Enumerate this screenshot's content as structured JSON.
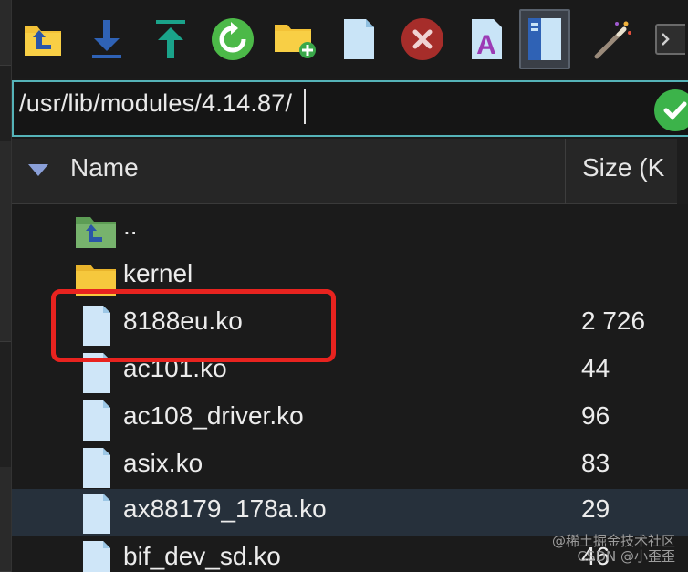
{
  "toolbar": {
    "buttons": [
      {
        "name": "parent-directory",
        "icon": "folder-up-icon"
      },
      {
        "name": "download",
        "icon": "download-icon"
      },
      {
        "name": "upload",
        "icon": "upload-icon"
      },
      {
        "name": "refresh",
        "icon": "refresh-icon"
      },
      {
        "name": "new-folder",
        "icon": "new-folder-icon"
      },
      {
        "name": "new-file",
        "icon": "new-file-icon"
      },
      {
        "name": "delete",
        "icon": "delete-icon"
      },
      {
        "name": "rename",
        "icon": "rename-icon"
      },
      {
        "name": "toggle-panel",
        "icon": "panel-icon",
        "active": true
      },
      {
        "name": "tools",
        "icon": "magic-wand-icon"
      },
      {
        "name": "terminal",
        "icon": "terminal-icon"
      }
    ]
  },
  "address": {
    "path": "/usr/lib/modules/4.14.87/"
  },
  "columns": {
    "name": "Name",
    "size": "Size (K"
  },
  "files": [
    {
      "name": "..",
      "size": "",
      "type": "parent"
    },
    {
      "name": "kernel",
      "size": "",
      "type": "folder"
    },
    {
      "name": "8188eu.ko",
      "size": "2 726",
      "type": "file",
      "highlighted": true
    },
    {
      "name": "ac101.ko",
      "size": "44",
      "type": "file"
    },
    {
      "name": "ac108_driver.ko",
      "size": "96",
      "type": "file"
    },
    {
      "name": "asix.ko",
      "size": "83",
      "type": "file"
    },
    {
      "name": "ax88179_178a.ko",
      "size": "29",
      "type": "file",
      "selected": true
    },
    {
      "name": "bif_dev_sd.ko",
      "size": "46",
      "type": "file"
    }
  ],
  "watermark": {
    "line1": "@稀土掘金技术社区",
    "line2": "CSDN @小歪歪"
  },
  "colors": {
    "accent": "#55b3b8",
    "annotation": "#e8231f",
    "selected_row": "#26303b"
  }
}
